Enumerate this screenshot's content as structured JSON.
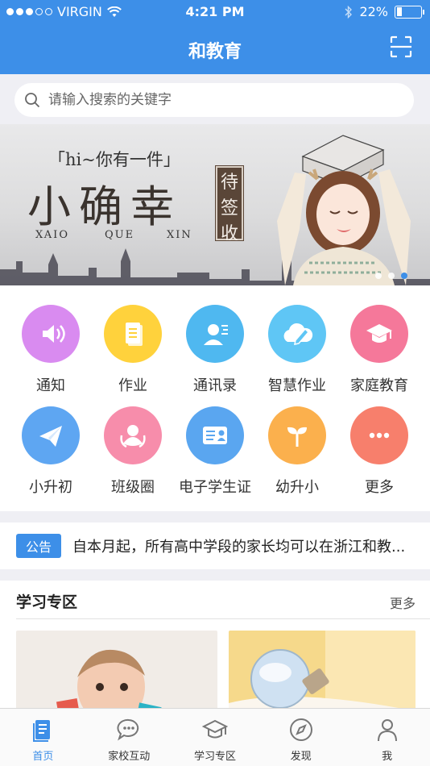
{
  "status_bar": {
    "carrier": "VIRGIN",
    "time": "4:21 PM",
    "battery": "22%",
    "battery_level": 0.22
  },
  "header": {
    "title": "和教育"
  },
  "search": {
    "placeholder": "请输入搜索的关键字"
  },
  "banner": {
    "tagline": "「hi~你有一件」",
    "headline": "小确幸",
    "pinyin": [
      "XAIO",
      "QUE",
      "XIN"
    ],
    "stamp": [
      "待",
      "签",
      "收"
    ],
    "pages": 3,
    "active_page": 3
  },
  "grid": {
    "items": [
      {
        "label": "通知",
        "icon": "speaker-icon",
        "color": "#d98bf0"
      },
      {
        "label": "作业",
        "icon": "document-icon",
        "color": "#ffd23c"
      },
      {
        "label": "通讯录",
        "icon": "contacts-icon",
        "color": "#4fb8f0"
      },
      {
        "label": "智慧作业",
        "icon": "cloud-pen-icon",
        "color": "#5fc6f5"
      },
      {
        "label": "家庭教育",
        "icon": "graduation-cap-icon",
        "color": "#f5789a"
      },
      {
        "label": "小升初",
        "icon": "paper-plane-icon",
        "color": "#5ea6f2"
      },
      {
        "label": "班级圈",
        "icon": "class-circle-icon",
        "color": "#f78dab"
      },
      {
        "label": "电子学生证",
        "icon": "id-card-icon",
        "color": "#5aa6f0"
      },
      {
        "label": "幼升小",
        "icon": "sprout-icon",
        "color": "#fbb04d"
      },
      {
        "label": "更多",
        "icon": "more-icon",
        "color": "#f77f6c"
      }
    ]
  },
  "notice": {
    "tag": "公告",
    "text": "自本月起，所有高中学段的家长均可以在浙江和教..."
  },
  "study": {
    "title": "学习专区",
    "more": "更多"
  },
  "tabbar": {
    "items": [
      {
        "label": "首页",
        "icon": "home-doc-icon",
        "active": true
      },
      {
        "label": "家校互动",
        "icon": "chat-bubble-icon",
        "active": false
      },
      {
        "label": "学习专区",
        "icon": "graduation-cap-icon",
        "active": false
      },
      {
        "label": "发现",
        "icon": "compass-icon",
        "active": false
      },
      {
        "label": "我",
        "icon": "person-icon",
        "active": false
      }
    ]
  },
  "colors": {
    "primary": "#3d8fe8",
    "background": "#efeff4"
  }
}
